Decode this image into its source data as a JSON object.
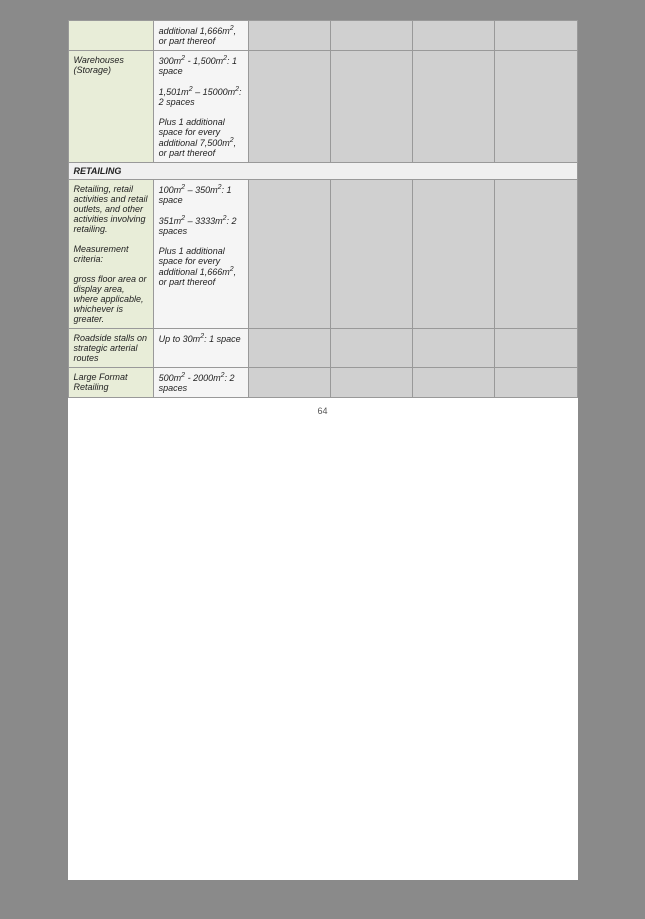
{
  "page": {
    "number": "64"
  },
  "table": {
    "rows": [
      {
        "type": "data",
        "col1": "",
        "col2": "additional 1,666m², or part thereof",
        "col3": "",
        "col4": "",
        "col5": "",
        "col6": ""
      },
      {
        "type": "data",
        "col1": "Warehouses (Storage)",
        "col2": "300m² - 1,500m²: 1 space\n\n1,501m² – 15000m²: 2 spaces\n\nPlus 1 additional space for every additional 7,500m², or part thereof",
        "col3": "",
        "col4": "",
        "col5": "",
        "col6": ""
      },
      {
        "type": "section",
        "col1": "RETAILING",
        "col2": "",
        "col3": "",
        "col4": "",
        "col5": "",
        "col6": ""
      },
      {
        "type": "data",
        "col1": "Retailing, retail activities and retail outlets, and other activities involving retailing.\n\nMeasurement criteria:\n\ngross floor area or display area, where applicable, whichever is greater.",
        "col2": "100m² – 350m²: 1 space\n\n351m² – 3333m²: 2 spaces\n\nPlus 1 additional space for every additional 1,666m², or part thereof",
        "col3": "",
        "col4": "",
        "col5": "",
        "col6": ""
      },
      {
        "type": "data",
        "col1": "Roadside stalls on strategic arterial routes",
        "col2": "Up to 30m²: 1 space",
        "col3": "",
        "col4": "",
        "col5": "",
        "col6": ""
      },
      {
        "type": "data",
        "col1": "Large Format Retailing",
        "col2": "500m² - 2000m²: 2 spaces",
        "col3": "",
        "col4": "",
        "col5": "",
        "col6": ""
      }
    ]
  }
}
